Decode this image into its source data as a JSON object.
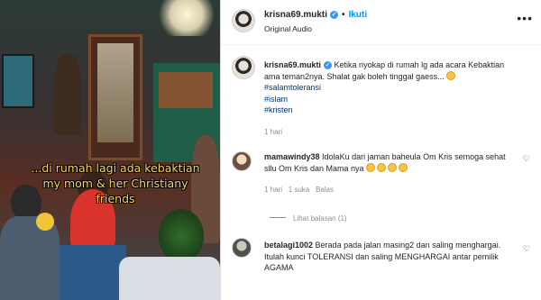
{
  "video": {
    "caption": "...di rumah lagi ada kebaktian my mom & her Christiany friends"
  },
  "header": {
    "username": "krisna69.mukti",
    "verified_mark": "✓",
    "follow_label": "Ikuti",
    "audio_label": "Original Audio",
    "more_icon": "more-horizontal-icon"
  },
  "caption": {
    "username": "krisna69.mukti",
    "text": "Ketika nyokap di rumah lg ada acara Kebaktian ama teman2nya. Shalat gak boleh tinggal gaess...",
    "hashtags": [
      "#salamtoleransi",
      "#islam",
      "#kristen"
    ],
    "time": "1 hari"
  },
  "comments": [
    {
      "username": "mamawindy38",
      "text": "IdolaKu dari jaman baheula Om Kris semoga sehat sllu Om Kris dan Mama nya",
      "time": "1 hari",
      "likes": "1 suka",
      "reply_label": "Balas"
    },
    {
      "username": "betalagi1002",
      "text": "Berada pada jalan masing2 dan saling menghargai. Itulah kunci TOLERANSI dan saling MENGHARGAI antar pemilik AGAMA"
    }
  ],
  "replies_label": "Lihat balasan (1)"
}
